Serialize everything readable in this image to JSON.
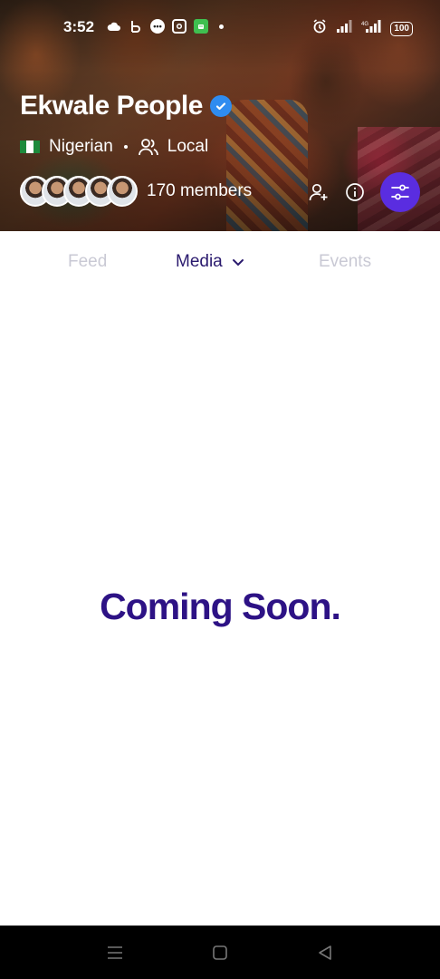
{
  "status_bar": {
    "time": "3:52",
    "battery": "100",
    "icons_left": [
      "cloud-icon",
      "b-icon",
      "chat-bubble-icon",
      "instagram-icon",
      "android-app-icon",
      "dot-icon"
    ],
    "icons_right": [
      "alarm-icon",
      "signal-icon",
      "lte-signal-icon",
      "battery-icon"
    ]
  },
  "group": {
    "name": "Ekwale People",
    "verified": true,
    "flag_colors": [
      "#1d8a3c",
      "#ffffff",
      "#1d8a3c"
    ],
    "nationality": "Nigerian",
    "scope": "Local",
    "members_label": "170 members",
    "avatar_count": 5
  },
  "tabs": {
    "feed": "Feed",
    "media": "Media",
    "events": "Events",
    "active": "media"
  },
  "content": {
    "message": "Coming Soon."
  },
  "colors": {
    "accent": "#5a2de0",
    "heading": "#2d1285",
    "tab_active": "#2a1a6e",
    "tab_inactive": "#c9c9d4",
    "verified": "#2f8cf0"
  },
  "nav_bar": {
    "buttons": [
      "menu-icon",
      "home-icon",
      "back-icon"
    ]
  }
}
